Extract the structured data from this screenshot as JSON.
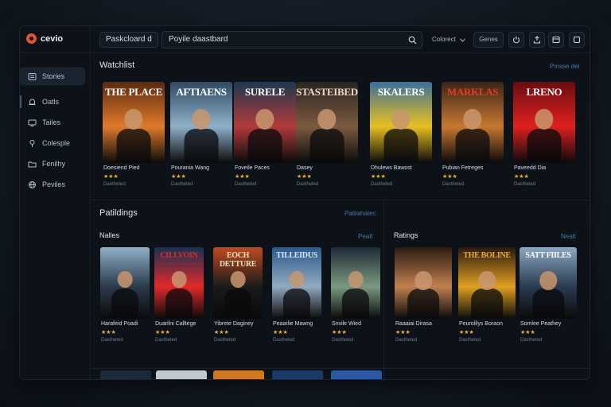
{
  "app": {
    "name": "cevio"
  },
  "header": {
    "breadcrumb": "Paskcloard d",
    "search_value": "Poyile daastbard",
    "select_value": "Colorect",
    "button_label": "Genes"
  },
  "sidebar": {
    "items": [
      {
        "label": "Stories",
        "icon": "layers-icon"
      },
      {
        "label": "Oatls",
        "icon": "bell-icon"
      },
      {
        "label": "Tailes",
        "icon": "monitor-icon"
      },
      {
        "label": "Colesple",
        "icon": "pin-icon"
      },
      {
        "label": "Fenilhy",
        "icon": "folder-icon"
      },
      {
        "label": "Peviles",
        "icon": "globe-icon"
      }
    ]
  },
  "watchlist": {
    "title": "Watchlist",
    "link": "Pmsse del",
    "items": [
      {
        "poster_title": "THE PLACE",
        "caption": "Doesiend Pied",
        "meta": "Daetheted",
        "stars": "★★★",
        "bg": "#5a2a10",
        "accent": "#e07a2a",
        "title_color": "#ffffff"
      },
      {
        "poster_title": "AFTIAENS",
        "caption": "Pourania Wang",
        "meta": "Dastheted",
        "stars": "★★★",
        "bg": "#2f4a63",
        "accent": "#8fb0c9",
        "title_color": "#ffffff"
      },
      {
        "poster_title": "SURELE",
        "caption": "Foveile Paces",
        "meta": "Dastheted",
        "stars": "★★★",
        "bg": "#1e3850",
        "accent": "#b23a3a",
        "title_color": "#ffffff"
      },
      {
        "poster_title": "STASTEIBED",
        "caption": "Dasey",
        "meta": "Dastheted",
        "stars": "★★★",
        "bg": "#2a2420",
        "accent": "#7a5a40",
        "title_color": "#e8d8c0"
      },
      {
        "poster_title": "SKALERS",
        "caption": "Dhulews Bawost",
        "meta": "Dastheted",
        "stars": "★★★",
        "bg": "#3a6f9a",
        "accent": "#e8c020",
        "title_color": "#ffffff"
      },
      {
        "poster_title": "MARKLAS",
        "caption": "Pubian Fetreges",
        "meta": "Dastheted",
        "stars": "★★★",
        "bg": "#3a2418",
        "accent": "#c87830",
        "title_color": "#e83a20"
      },
      {
        "poster_title": "LRENO",
        "caption": "Paveedd Dia",
        "meta": "Dastheted",
        "stars": "★★★",
        "bg": "#6a0c10",
        "accent": "#e02020",
        "title_color": "#ffffff"
      }
    ]
  },
  "paddings": {
    "title": "Patildings",
    "link": "Patilahatec"
  },
  "nailes": {
    "title": "Nalles",
    "link": "Peatl",
    "items": [
      {
        "poster_title": "",
        "caption": "Harafeid Poadi",
        "meta": "Daetheted",
        "stars": "★★★",
        "bg": "#8fb0c8",
        "accent": "#2a3a4a",
        "title_color": "#ffffff"
      },
      {
        "poster_title": "CILLVOIN",
        "caption": "Duarilni Calltege",
        "meta": "Dastheted",
        "stars": "★★★",
        "bg": "#1a3050",
        "accent": "#e02a2a",
        "title_color": "#e02a2a"
      },
      {
        "poster_title": "EOCH DETTURE",
        "caption": "Yibrete Daginey",
        "meta": "Dastheted",
        "stars": "★★★",
        "bg": "#c04a20",
        "accent": "#1a1a1a",
        "title_color": "#f0e0c0"
      },
      {
        "poster_title": "TILLEIDUS",
        "caption": "Peaarlie Mawng",
        "meta": "Dastheted",
        "stars": "★★★",
        "bg": "#2a5a8a",
        "accent": "#90aac0",
        "title_color": "#d8e8f8"
      },
      {
        "poster_title": "",
        "caption": "Snvile Wied",
        "meta": "Dastheted",
        "stars": "★★★",
        "bg": "#1e2a36",
        "accent": "#7a9a80",
        "title_color": "#ffffff"
      }
    ]
  },
  "ratings": {
    "title": "Ratings",
    "link": "Neatl",
    "items": [
      {
        "poster_title": "",
        "caption": "Raaaiai Dirasa",
        "meta": "Dastheted",
        "stars": "★★★",
        "bg": "#2a1a10",
        "accent": "#c08050",
        "title_color": "#ffffff"
      },
      {
        "poster_title": "THE BOLINE",
        "caption": "Peurolilys Boraon",
        "meta": "Dastheted",
        "stars": "★★★",
        "bg": "#2a1810",
        "accent": "#e0a020",
        "title_color": "#e8b020"
      },
      {
        "poster_title": "SATT FIILES",
        "caption": "Somlee Peathey",
        "meta": "Dastheted",
        "stars": "★★★",
        "bg": "#8aa8c0",
        "accent": "#2a3a50",
        "title_color": "#ffffff"
      }
    ]
  }
}
